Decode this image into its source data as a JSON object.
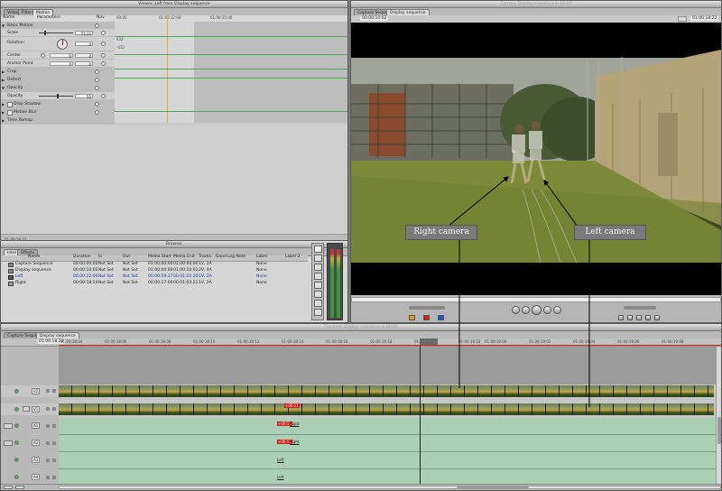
{
  "viewer": {
    "title": "Viewer: Left from Display sequence",
    "tabs": [
      "Video",
      "Filters",
      "Motion"
    ],
    "col_name": "Name",
    "col_params": "Parameters",
    "col_nav": "Nav",
    "ruler_start": "00:00",
    "ruler_tc1": "01:00:12:00",
    "ruler_tc2": "01:00:15:00",
    "basic_motion": "Basic Motion",
    "scale_label": "Scale",
    "scale_value": "71.11",
    "rotation_label": "Rotation",
    "rotation_value": "0",
    "rot_max": "432",
    "rot_min": "-432",
    "center_label": "Center",
    "center_x": "0",
    "center_y": "0",
    "anchor_label": "Anchor Point",
    "anchor_x": "0",
    "anchor_y": "0",
    "crop_label": "Crop",
    "distort_label": "Distort",
    "opacity_section": "Opacity",
    "opacity_label": "Opacity",
    "opacity_value": "55",
    "dropshadow_label": "Drop Shadow",
    "motionblur_label": "Motion Blur",
    "timeremap_label": "Time Remap",
    "bottom_tc": "01:00:18:22"
  },
  "canvas": {
    "title": "Canvas: Display sequence in 00:00",
    "tabs": [
      "Capture Sequence",
      "Display sequence"
    ],
    "tc_left": "00:00:10:02",
    "tc_right": "01:00:18:22",
    "label_right": "Right camera",
    "label_left": "Left camera"
  },
  "browser": {
    "title": "Browser",
    "tabs": [
      "Intel",
      "Effects"
    ],
    "columns": [
      "Name",
      "Duration",
      "In",
      "Out",
      "Media Start",
      "Media End",
      "Tracks",
      "Good",
      "Log Note",
      "Label",
      "Label 2"
    ],
    "rows": [
      {
        "name": "Capture Sequence",
        "duration": "00:00:00:00",
        "in": "Not Set",
        "out": "Not Set",
        "mstart": "01:00:00:00",
        "mend": "01:00:00:00",
        "tracks": "1V, 2A",
        "label": "None"
      },
      {
        "name": "Display sequence",
        "duration": "00:00:10:02",
        "in": "Not Set",
        "out": "Not Set",
        "mstart": "01:00:00:00",
        "mend": "01:00:10:01",
        "tracks": "2V, 4A",
        "label": "None"
      },
      {
        "name": "Left",
        "duration": "00:00:22:04",
        "in": "Not Set",
        "out": "Not Set",
        "mstart": "00:00:59:17",
        "mend": "00:01:22:20",
        "tracks": "1V, 2A",
        "label": "None"
      },
      {
        "name": "Right",
        "duration": "00:00:18:24",
        "in": "Not Set",
        "out": "Not Set",
        "mstart": "00:00:17:06",
        "mend": "00:01:03:21",
        "tracks": "1V, 2A",
        "label": "None"
      }
    ]
  },
  "timeline": {
    "title": "Timeline: Display sequence in 00:00",
    "tabs": [
      "Capture Sequence",
      "Display sequence"
    ],
    "tc": "01:00:18:22",
    "ruler": [
      "01:00:18:04",
      "01:00:18:06",
      "01:00:18:08",
      "01:00:18:10",
      "01:00:18:12",
      "01:00:18:14",
      "01:00:18:16",
      "01:00:18:18",
      "01:00:18:20",
      "01:00:18:22",
      "01:00:19:00",
      "01:00:19:02",
      "01:00:19:04",
      "01:00:19:06",
      "01:00:19:08"
    ],
    "tracks": [
      "V2",
      "V1",
      "A1",
      "A2",
      "A3",
      "A4"
    ],
    "clip_right": "Right",
    "clip_left": "Left",
    "badge": "+00:11"
  },
  "colors": {
    "audio_green": "#a9cfb4",
    "playhead": "#000000",
    "badge_red": "#d91c1c"
  }
}
